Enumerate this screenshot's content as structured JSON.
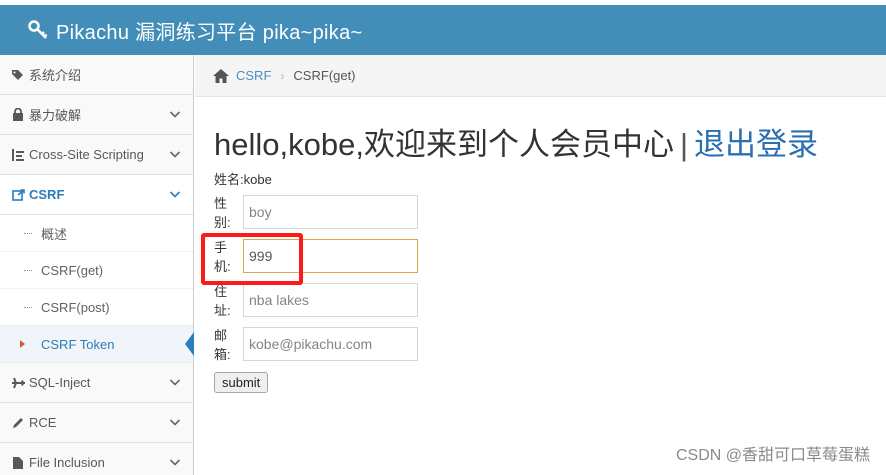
{
  "header": {
    "title": "Pikachu 漏洞练习平台 pika~pika~",
    "icon": "key-icon"
  },
  "sidebar": {
    "items": [
      {
        "label": "系统介绍",
        "icon": "tags-icon"
      },
      {
        "label": "暴力破解",
        "icon": "lock-icon"
      },
      {
        "label": "Cross-Site Scripting",
        "icon": "list-icon"
      },
      {
        "label": "CSRF",
        "icon": "share-icon"
      },
      {
        "label": "SQL-Inject",
        "icon": "plane-icon"
      },
      {
        "label": "RCE",
        "icon": "pencil-icon"
      },
      {
        "label": "File Inclusion",
        "icon": "file-icon"
      }
    ],
    "csrf_sub": [
      {
        "label": "概述"
      },
      {
        "label": "CSRF(get)"
      },
      {
        "label": "CSRF(post)"
      },
      {
        "label": "CSRF Token"
      }
    ]
  },
  "breadcrumb": {
    "home": "CSRF",
    "current": "CSRF(get)"
  },
  "main": {
    "welcome": "hello,kobe,欢迎来到个人会员中心",
    "separator": "|",
    "logout": "退出登录",
    "name_line": "姓名:kobe",
    "fields": [
      {
        "label": "性别:",
        "value": "boy"
      },
      {
        "label": "手机:",
        "value": "999"
      },
      {
        "label": "住址:",
        "value": "nba lakes"
      },
      {
        "label": "邮箱:",
        "value": "kobe@pikachu.com"
      }
    ],
    "submit": "submit"
  },
  "watermark": "CSDN @香甜可口草莓蛋糕",
  "colors": {
    "header": "#438eb9",
    "active": "#2b7dbc",
    "highlight": "#ff1a1a"
  }
}
